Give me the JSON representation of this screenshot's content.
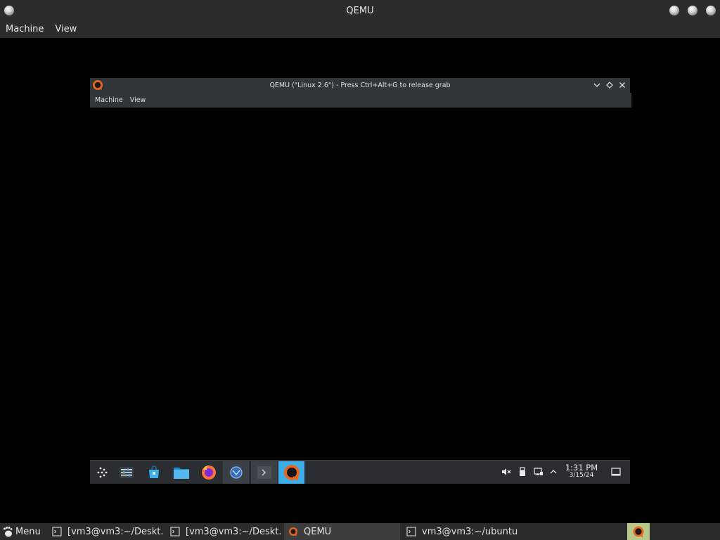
{
  "host_window": {
    "title": "QEMU",
    "menu": [
      "Machine",
      "View"
    ]
  },
  "guest_window": {
    "title": "QEMU (\"Linux 2.6\") - Press Ctrl+Alt+G to release grab",
    "menu": [
      "Machine",
      "View"
    ],
    "controls": [
      "minimize-icon",
      "maximize-icon",
      "close-icon"
    ]
  },
  "guest_panel": {
    "launchers": [
      "application-launcher-icon",
      "system-settings-icon",
      "discover-store-icon",
      "file-manager-icon",
      "firefox-icon",
      "network-globe-icon",
      "terminal-icon",
      "qemu-icon"
    ],
    "tray": [
      "audio-muted-icon",
      "usb-device-icon",
      "network-wired-icon",
      "chevron-up-icon"
    ],
    "time": "1:31 PM",
    "date": "3/15/24",
    "show_desktop": "show-desktop-icon"
  },
  "host_taskbar": {
    "menu_label": "Menu",
    "tasks": [
      {
        "label": "[vm3@vm3:~/Deskt...",
        "icon": "terminal-icon"
      },
      {
        "label": "[vm3@vm3:~/Deskt...",
        "icon": "terminal-icon"
      },
      {
        "label": "QEMU",
        "icon": "qemu-icon"
      },
      {
        "label": "vm3@vm3:~/ubuntu...",
        "icon": "terminal-icon"
      }
    ]
  },
  "colors": {
    "qemu_orange": "#e8661f",
    "panel_accent": "#3daee9",
    "tray_highlight": "#b7c98b"
  }
}
